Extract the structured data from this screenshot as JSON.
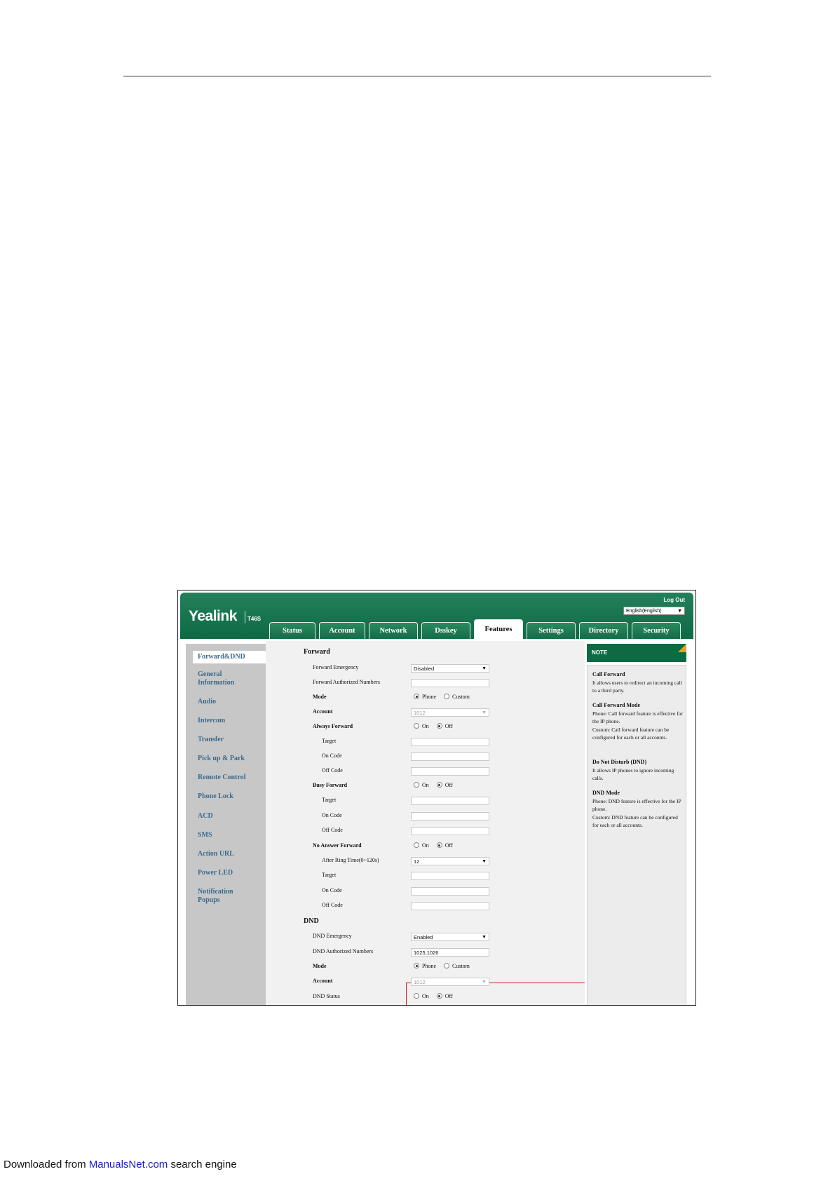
{
  "header": {
    "logo": "Yealink",
    "model": "T46S",
    "logout": "Log Out",
    "language": "English(English)"
  },
  "tabs": [
    "Status",
    "Account",
    "Network",
    "Dsskey",
    "Features",
    "Settings",
    "Directory",
    "Security"
  ],
  "active_tab": "Features",
  "sidebar": {
    "items": [
      {
        "label": "Forward&DND"
      },
      {
        "label": "General"
      },
      {
        "label": "Information"
      },
      {
        "label": "Audio"
      },
      {
        "label": "Intercom"
      },
      {
        "label": "Transfer"
      },
      {
        "label": "Pick up & Park"
      },
      {
        "label": "Remote Control"
      },
      {
        "label": "Phone Lock"
      },
      {
        "label": "ACD"
      },
      {
        "label": "SMS"
      },
      {
        "label": "Action URL"
      },
      {
        "label": "Power LED"
      },
      {
        "label": "Notification"
      },
      {
        "label": "Popups"
      }
    ]
  },
  "forward": {
    "title": "Forward",
    "emergency_label": "Forward Emergency",
    "emergency_value": "Disabled",
    "authorized_label": "Forward Authorized Numbers",
    "mode_label": "Mode",
    "mode_phone": "Phone",
    "mode_custom": "Custom",
    "account_label": "Account",
    "account_value": "1012",
    "always_label": "Always Forward",
    "busy_label": "Busy Forward",
    "noanswer_label": "No Answer Forward",
    "on": "On",
    "off": "Off",
    "target_label": "Target",
    "on_code_label": "On Code",
    "off_code_label": "Off Code",
    "ring_time_label": "After Ring Time(0~120s)",
    "ring_time_value": "12"
  },
  "dnd": {
    "title": "DND",
    "emergency_label": "DND Emergency",
    "emergency_value": "Enabled",
    "authorized_label": "DND Authorized Numbers",
    "authorized_value": "1025,1026",
    "mode_label": "Mode",
    "account_label": "Account",
    "account_value": "1012",
    "status_label": "DND Status"
  },
  "note": {
    "head": "NOTE",
    "call_forward_title": "Call Forward",
    "call_forward_text": "It allows users to redirect an incoming call to a third party.",
    "cf_mode_title": "Call Forward Mode",
    "cf_mode_phone": "Phone: Call forward feature is effective for the IP phone.",
    "cf_mode_custom": "Custom: Call forward feature can be configured for each or all accounts.",
    "dnd_title": "Do Not Disturb (DND)",
    "dnd_text": "It allows IP phones to ignore incoming calls.",
    "dnd_mode_title": "DND Mode",
    "dnd_mode_phone": "Phone: DND feature is effective for the IP phone.",
    "dnd_mode_custom": "Custom: DND feature can be configured for each or all accounts."
  },
  "footer": {
    "prefix": "Downloaded from ",
    "link": "ManualsNet.com",
    "suffix": " search engine"
  }
}
